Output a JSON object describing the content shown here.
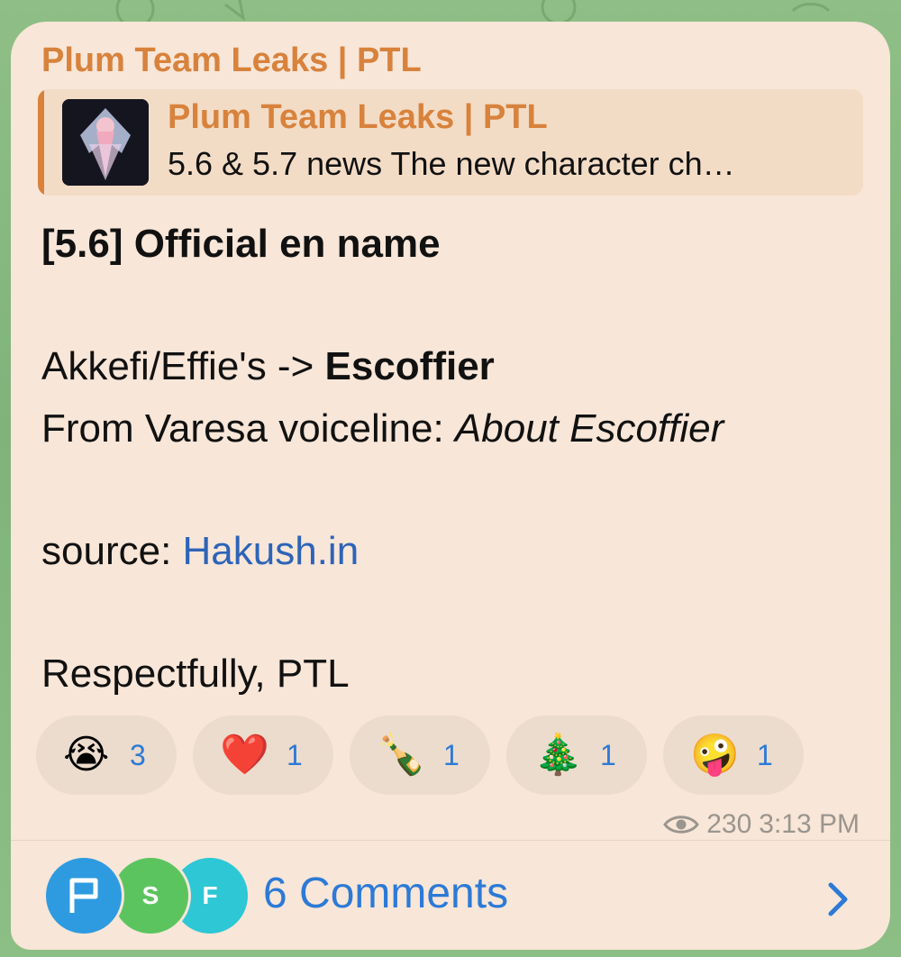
{
  "channel": {
    "name": "Plum Team Leaks | PTL"
  },
  "reply": {
    "title": "Plum Team Leaks | PTL",
    "text": "5.6 & 5.7 news The new character ch…"
  },
  "message": {
    "heading": "[5.6] Official en name",
    "line1_prefix": "Akkefi/Effie's -> ",
    "line1_bold": "Escoffier",
    "line2_prefix": "From Varesa voiceline: ",
    "line2_italic": "About Escoffier",
    "source_prefix": "source: ",
    "source_link": "Hakush.in",
    "signature": "Respectfully, PTL"
  },
  "reactions": [
    {
      "emoji": "😭",
      "count": "3",
      "icon": "loudly-crying-face-emoji"
    },
    {
      "emoji": "❤️",
      "count": "1",
      "icon": "red-heart-emoji"
    },
    {
      "emoji": "🍾",
      "count": "1",
      "icon": "champagne-bottle-emoji"
    },
    {
      "emoji": "🎄",
      "count": "1",
      "icon": "christmas-tree-emoji"
    },
    {
      "emoji": "🤪",
      "count": "1",
      "icon": "zany-face-emoji"
    }
  ],
  "meta": {
    "views": "230",
    "time": "3:13 PM"
  },
  "comments": {
    "label": "6 Comments",
    "avatars": [
      {
        "letter": "",
        "color": "#2e9be0",
        "icon": "flag-icon"
      },
      {
        "letter": "S",
        "color": "#5cc45f"
      },
      {
        "letter": "F",
        "color": "#2dc7d6"
      }
    ]
  },
  "colors": {
    "accent": "#d8823c",
    "link": "#2c64b8",
    "count": "#2c7ad6",
    "bubble": "#f8e6d8"
  }
}
